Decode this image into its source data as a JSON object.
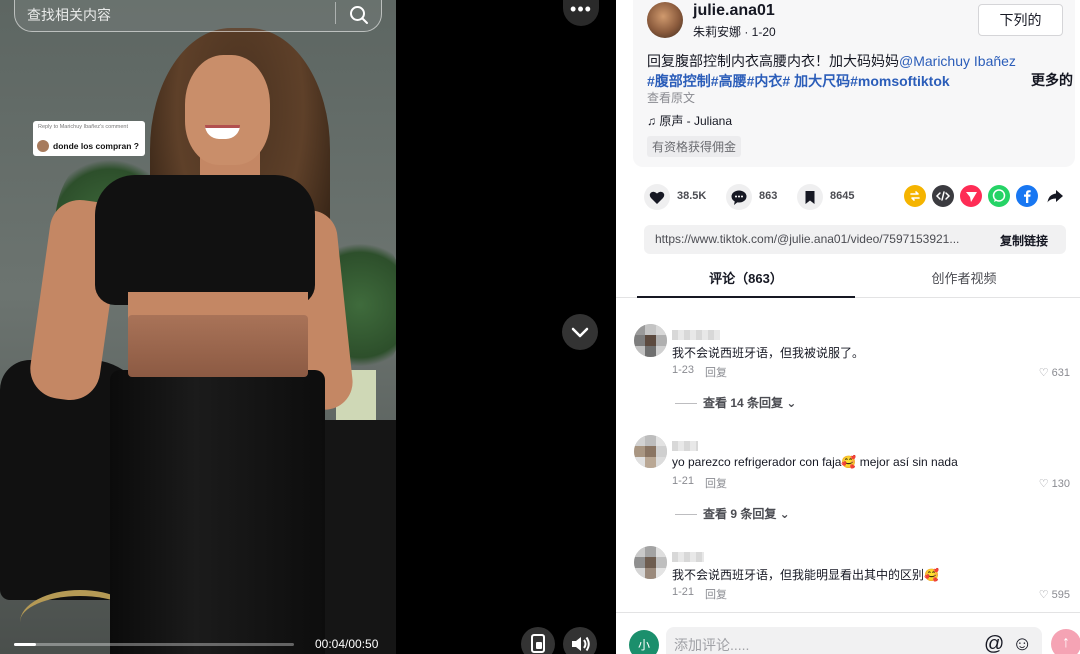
{
  "search": {
    "placeholder": "查找相关内容"
  },
  "video": {
    "sticker_reply_text": "Reply to Marichuy Ibañez's comment",
    "sticker_comment": "donde los compran ?",
    "time": "00:04/00:50",
    "progress_fraction": 0.08,
    "more_label": "•••"
  },
  "author": {
    "name": "julie.ana01",
    "meta": "朱莉安娜 · 1-20",
    "follow_label": "下列的"
  },
  "caption": {
    "text": "回复腹部控制内衣高腰内衣！加大码妈妈",
    "mention": "@Marichuy Ibañez",
    "tags": [
      "#腹部控制",
      "#高腰",
      "#内衣",
      "# 加大尺码",
      "#momsoftiktok"
    ],
    "more_label": "更多的",
    "see_original": "查看原文",
    "music": "♫  原声 - Juliana",
    "commission": "有资格获得佣金"
  },
  "stats": {
    "likes": "38.5K",
    "comments": "863",
    "saves": "8645"
  },
  "share": {
    "link": "https://www.tiktok.com/@julie.ana01/video/7597153921...",
    "copy_label": "复制链接",
    "icon_colors": {
      "repost": "#f5b400",
      "embed": "#3b3b40",
      "send": "#fe2c55",
      "whatsapp": "#25d366",
      "facebook": "#1877f2"
    }
  },
  "tabs": {
    "comments": "评论（863）",
    "creator_videos": "创作者视频"
  },
  "comments": [
    {
      "text": "我不会说西班牙语，但我被说服了。",
      "date": "1-23",
      "reply_label": "回复",
      "likes": "♡ 631",
      "view_replies": "查看 14 条回复 ⌄"
    },
    {
      "text": "yo parezco refrigerador con faja🥰 mejor así sin nada",
      "date": "1-21",
      "reply_label": "回复",
      "likes": "♡ 130",
      "view_replies": "查看 9 条回复 ⌄"
    },
    {
      "text": "我不会说西班牙语，但我能明显看出其中的区别🥰",
      "date": "1-21",
      "reply_label": "回复",
      "likes": "♡ 595"
    }
  ],
  "comment_bar": {
    "avatar_label": "小",
    "placeholder": "添加评论.....",
    "mention_icon": "@",
    "emoji_icon": "☺",
    "post_icon": "↑"
  }
}
